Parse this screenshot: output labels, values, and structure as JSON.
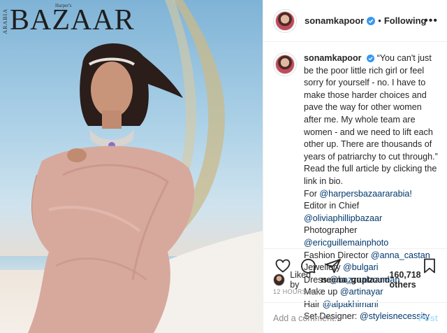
{
  "magazine": {
    "title": "BAZAAR",
    "side_text": "ARABIA",
    "small_text": "Harper's"
  },
  "header": {
    "username": "sonamkapoor",
    "separator": "•",
    "following_label": "Following",
    "more_label": "•••"
  },
  "caption": {
    "username": "sonamkapoor",
    "text": "“You can't just be the poor little rich girl or feel sorry for yourself - no. I have to make those harder choices and pave the way for other women after me. My whole team are women - and we need to lift each other up. There are thousands of years of patriarchy to cut through.” Read the full article by clicking the link in bio.",
    "credits": [
      {
        "label": "For ",
        "mention": "@harpersbazaararabia!"
      },
      {
        "label": "Editor in Chief ",
        "mention": "@oliviaphillipbazaar"
      },
      {
        "label": "Photographer ",
        "mention": "@ericguillemainphoto"
      },
      {
        "label": "Fashion Director ",
        "mention": "@anna_castan"
      },
      {
        "label": "Jewellery ",
        "mention": "@bulgari"
      },
      {
        "label": "Dress ",
        "mention": "@bazzaalzouman"
      },
      {
        "label": "Make up ",
        "mention": "@artinayar"
      },
      {
        "label": "Hair ",
        "mention": "@alpakhimani"
      },
      {
        "label": "Set Designer: ",
        "mention": "@styleisnecessity"
      }
    ],
    "time_ago": "12h"
  },
  "likes": {
    "prefix": "Liked by ",
    "user": "neena_gupta",
    "middle": " and ",
    "count": "160,718 others"
  },
  "date": "12 HOURS AGO",
  "comment": {
    "placeholder": "Add a comment...",
    "post_label": "Post"
  },
  "icons": {
    "like": "heart-icon",
    "comment": "comment-icon",
    "share": "share-icon",
    "save": "bookmark-icon",
    "verified": "verified-badge-icon"
  },
  "colors": {
    "link": "#00376b",
    "verified": "#3897f0",
    "muted": "#8e8e8e",
    "post_button": "#b2dffc"
  }
}
